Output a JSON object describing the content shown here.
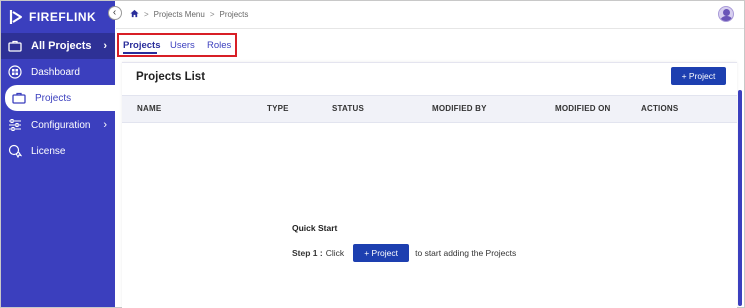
{
  "brand": {
    "name": "FIREFLINK"
  },
  "sidebar": {
    "items": [
      {
        "label": "All Projects",
        "icon": "briefcase-icon",
        "chevron": "›"
      },
      {
        "label": "Dashboard",
        "icon": "dashboard-icon"
      },
      {
        "label": "Projects",
        "icon": "briefcase-icon"
      },
      {
        "label": "Configuration",
        "icon": "sliders-icon",
        "chevron": "›"
      },
      {
        "label": "License",
        "icon": "license-icon"
      }
    ]
  },
  "breadcrumb": {
    "home_icon": "home-icon",
    "items": [
      "Projects Menu",
      "Projects"
    ],
    "separator": ">"
  },
  "tabs": [
    {
      "label": "Projects",
      "active": true
    },
    {
      "label": "Users",
      "active": false
    },
    {
      "label": "Roles",
      "active": false
    }
  ],
  "projects_list": {
    "title": "Projects List",
    "add_button": "+ Project",
    "columns": [
      "NAME",
      "TYPE",
      "STATUS",
      "MODIFIED BY",
      "MODIFIED ON",
      "ACTIONS"
    ]
  },
  "quick_start": {
    "title": "Quick Start",
    "step_label": "Step 1 :",
    "step_prefix": "Click",
    "step_button": "+ Project",
    "step_suffix": "to start adding the Projects"
  },
  "colors": {
    "sidebar": "#3b3fbe",
    "primary_button": "#1d3fb0",
    "highlight_box": "#d81f26"
  }
}
